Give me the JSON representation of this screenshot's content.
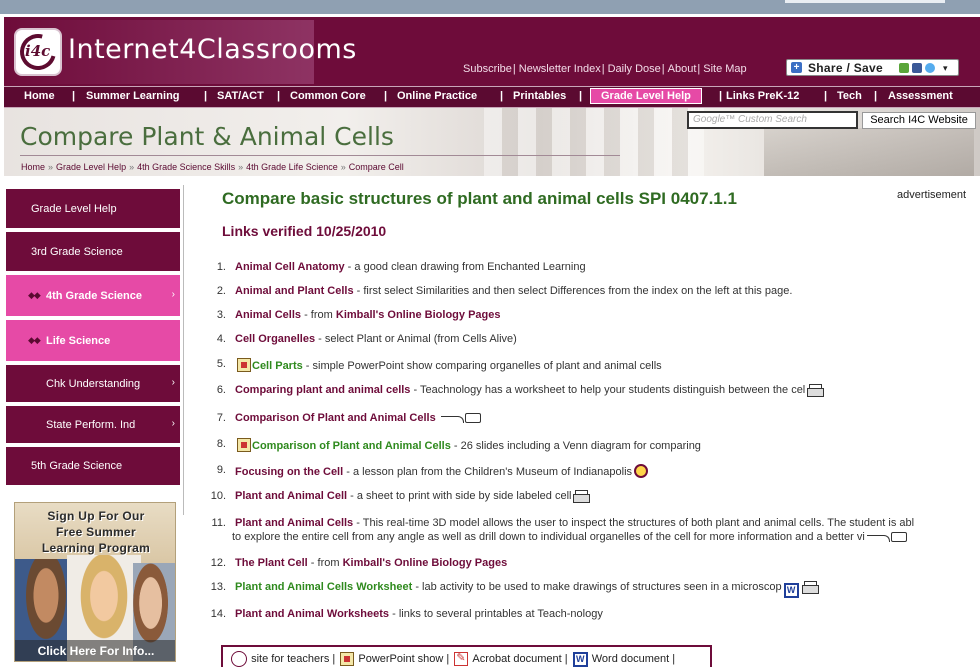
{
  "site": {
    "title": "Internet4Classrooms",
    "logo_text": "i4c",
    "top_links": [
      "Subscribe",
      "Newsletter Index",
      "Daily Dose",
      "About",
      "Site Map"
    ],
    "share_label": "Share / Save"
  },
  "nav": {
    "items": [
      "Home",
      "Summer Learning",
      "SAT/ACT",
      "Common Core",
      "Online Practice",
      "Printables",
      "Grade Level Help",
      "Links PreK-12",
      "Tech",
      "Assessment"
    ],
    "active": "Grade Level Help"
  },
  "banner": {
    "page_title": "Compare Plant & Animal Cells",
    "breadcrumbs": [
      "Home",
      "Grade Level Help",
      "4th Grade Science Skills",
      "4th Grade Life Science",
      "Compare Cell"
    ],
    "search_placeholder": "Google™ Custom Search",
    "search_button": "Search I4C Website"
  },
  "sidebar": {
    "items": [
      {
        "label": "Grade Level Help",
        "style": "dark",
        "chevron": false
      },
      {
        "label": "3rd Grade Science",
        "style": "dark",
        "chevron": false
      },
      {
        "label": "4th Grade Science",
        "style": "pink",
        "chevron": true
      },
      {
        "label": "Life Science",
        "style": "pink",
        "chevron": false
      },
      {
        "label": "Chk Understanding",
        "style": "dark",
        "chevron": true
      },
      {
        "label": "State Perform. Ind",
        "style": "dark",
        "chevron": true
      },
      {
        "label": "5th Grade Science",
        "style": "dark",
        "chevron": false
      }
    ],
    "promo": {
      "lines": [
        "Sign Up For Our",
        "Free Summer",
        "Learning Program"
      ],
      "cta": "Click Here For Info..."
    }
  },
  "main": {
    "heading": "Compare basic structures of plant and animal cells SPI 0407.1.1",
    "advertisement": "advertisement",
    "verified": "Links verified 10/25/2010",
    "links": [
      {
        "n": "1.",
        "title": "Animal Cell Anatomy",
        "desc": " - a good clean drawing from Enchanted Learning",
        "color": "maroon",
        "icons_before": [],
        "icons_after": []
      },
      {
        "n": "2.",
        "title": "Animal and Plant Cells",
        "desc": " - first select Similarities and then select Differences from the index on the left at this page.",
        "color": "maroon",
        "icons_before": [],
        "icons_after": []
      },
      {
        "n": "3.",
        "title": "Animal Cells",
        "desc": " - from ",
        "extra_link": "Kimball's Online Biology Pages",
        "color": "maroon",
        "icons_before": [],
        "icons_after": []
      },
      {
        "n": "4.",
        "title": "Cell Organelles",
        "desc": " - select Plant or Animal (from Cells Alive)",
        "color": "maroon",
        "icons_before": [],
        "icons_after": []
      },
      {
        "n": "5.",
        "title": "Cell Parts",
        "desc": " - simple PowerPoint show comparing organelles of plant and animal cells",
        "color": "green",
        "icons_before": [
          "powerpoint-icon"
        ],
        "icons_after": []
      },
      {
        "n": "6.",
        "title": "Comparing plant and animal cells",
        "desc": "  - Teachnology has a worksheet to help your students distinguish between the cel",
        "color": "maroon",
        "icons_before": [],
        "icons_after": [
          "printer-icon"
        ]
      },
      {
        "n": "7.",
        "title": "Comparison Of Plant and Animal Cells",
        "desc": " ",
        "color": "maroon",
        "icons_before": [],
        "icons_after": [
          "plugin-icon"
        ]
      },
      {
        "n": "8.",
        "title": "Comparison of Plant and Animal Cells",
        "desc": " - 26 slides including a Venn diagram for comparing",
        "color": "green",
        "icons_before": [
          "powerpoint-icon"
        ],
        "icons_after": []
      },
      {
        "n": "9.",
        "title": "Focusing on the Cell",
        "desc": " - a lesson plan from the Children's Museum of Indianapolis",
        "color": "maroon",
        "icons_before": [],
        "icons_after": [
          "teacher-icon"
        ]
      },
      {
        "n": "10.",
        "title": "Plant and Animal Cell",
        "desc": " - a sheet to print with side by side labeled cell",
        "color": "maroon",
        "icons_before": [],
        "icons_after": [
          "printer-icon"
        ]
      },
      {
        "n": "11.",
        "title": "Plant and Animal Cells",
        "desc": " - This real-time 3D model allows the user to inspect the structures of both plant and animal cells. The student is abl",
        "desc2": "to explore the entire cell from any angle as well as drill down to individual organelles of the cell for more information and a better vi",
        "color": "maroon",
        "icons_before": [],
        "icons_after": [
          "plugin-icon"
        ]
      },
      {
        "n": "12.",
        "title": "The Plant Cell",
        "desc": " - from ",
        "extra_link": "Kimball's Online Biology Pages",
        "color": "maroon",
        "icons_before": [],
        "icons_after": []
      },
      {
        "n": "13.",
        "title": "Plant and Animal Cells Worksheet",
        "desc": " - lab activity to be used to make drawings of structures seen in a microscop",
        "color": "green",
        "icons_before": [],
        "icons_after": [
          "word-icon",
          "printer-icon"
        ]
      },
      {
        "n": "14.",
        "title": "Plant and Animal Worksheets",
        "desc": " - links to several printables at Teach-nology",
        "color": "maroon",
        "icons_before": [],
        "icons_after": []
      }
    ],
    "legend": [
      "site for teachers",
      "PowerPoint show",
      "Acrobat document",
      "Word document"
    ]
  },
  "colors": {
    "brand_maroon": "#6e0c3a",
    "accent_pink": "#e64aa6",
    "heading_green": "#2f6b22",
    "link_green": "#2f8a1e"
  }
}
